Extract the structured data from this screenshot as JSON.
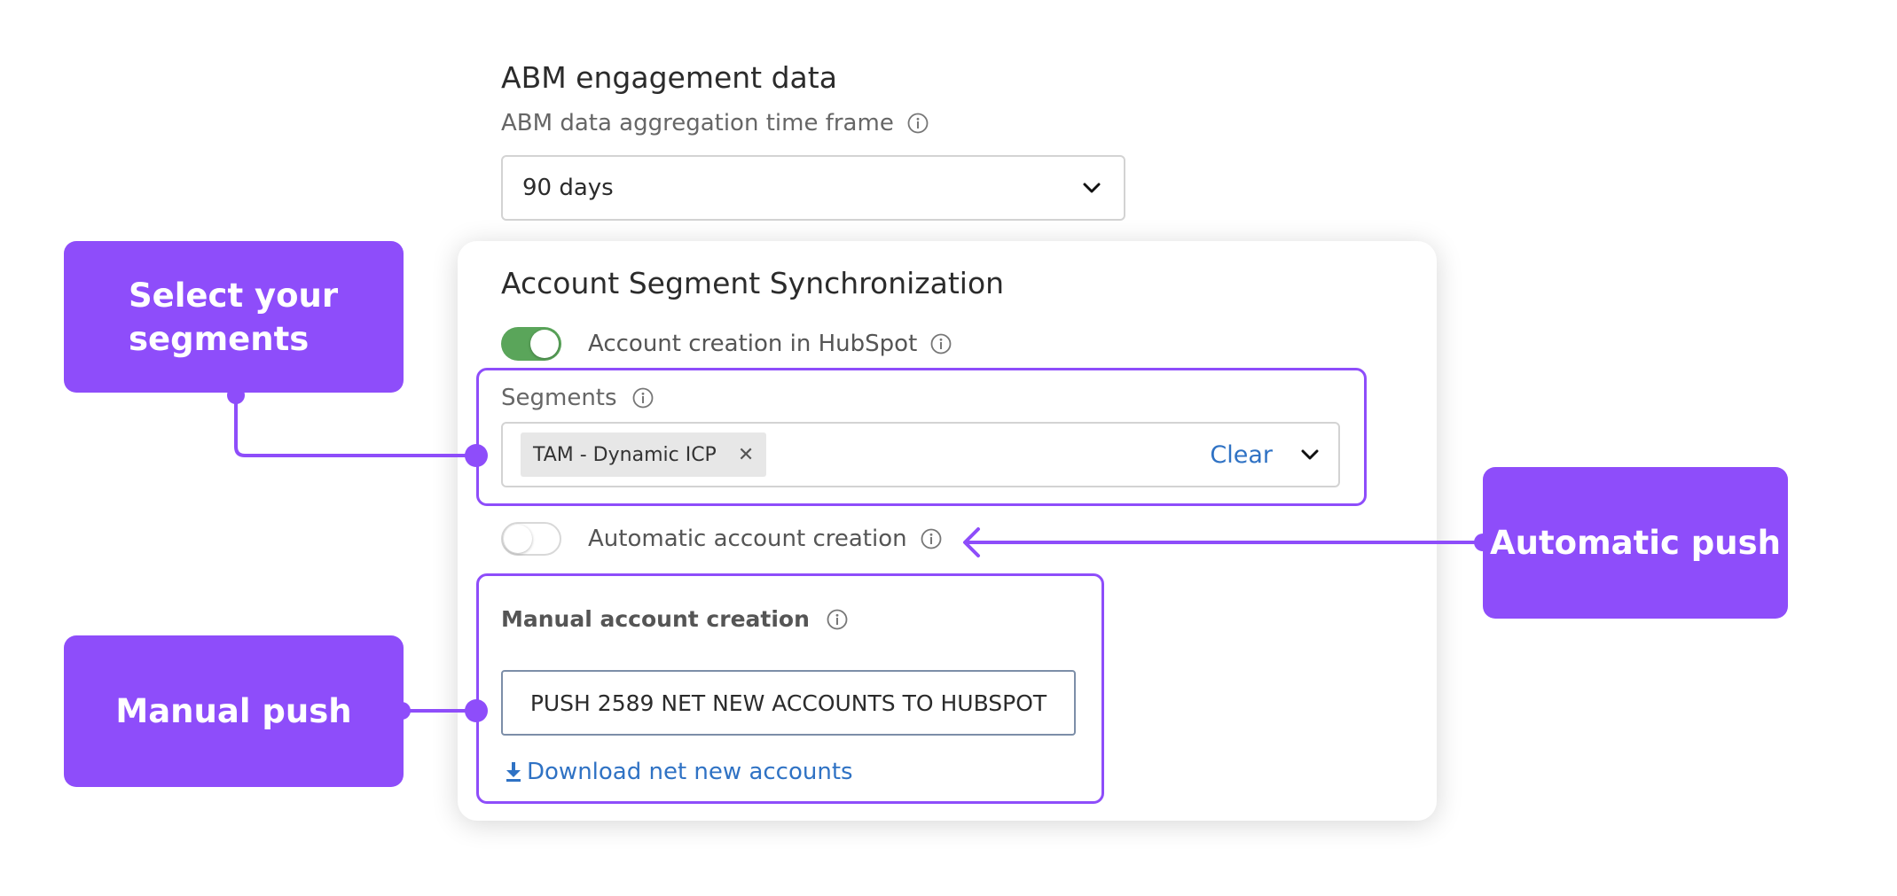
{
  "abm": {
    "title": "ABM engagement data",
    "timeframe_label": "ABM data aggregation time frame",
    "timeframe_value": "90 days"
  },
  "sync": {
    "title": "Account Segment Synchronization",
    "hubspot_toggle_label": "Account creation in HubSpot",
    "hubspot_toggle_on": true,
    "segments_label": "Segments",
    "segment_chips": [
      "TAM - Dynamic ICP"
    ],
    "chip_remove_glyph": "✕",
    "clear_label": "Clear",
    "auto_toggle_label": "Automatic account creation",
    "auto_toggle_on": false,
    "manual_label": "Manual account creation",
    "push_button_label": "PUSH 2589 NET NEW ACCOUNTS TO HUBSPOT",
    "download_label": "Download net new accounts"
  },
  "callouts": {
    "select_segments_line1": "Select your",
    "select_segments_line2": "segments",
    "automatic_push": "Automatic push",
    "manual_push": "Manual push"
  },
  "colors": {
    "accent_purple": "#8e4dfa",
    "toggle_on_green": "#5aa55a",
    "link_blue": "#2f72c4"
  },
  "icons": {
    "info": "info-icon",
    "dropdown": "chevron-down-icon",
    "remove": "close-icon",
    "download": "download-icon"
  }
}
